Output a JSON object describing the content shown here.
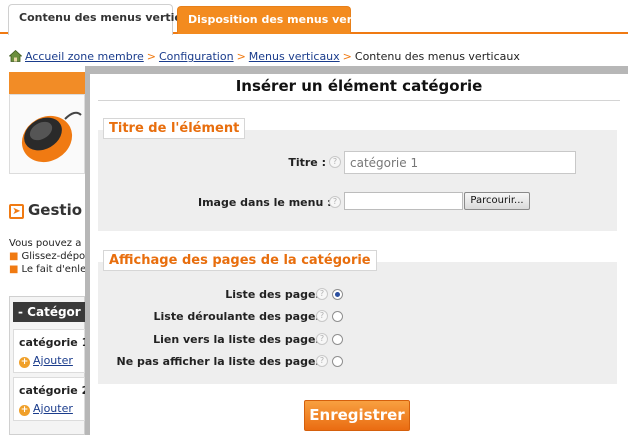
{
  "tabs": [
    {
      "label": "Contenu des menus verticaux",
      "active": true
    },
    {
      "label": "Disposition des menus verticaux",
      "active": false
    }
  ],
  "breadcrumb": {
    "items": [
      "Accueil zone membre",
      "Configuration",
      "Menus verticaux"
    ],
    "current": "Contenu des menus verticaux",
    "separator": ">"
  },
  "background": {
    "section_title": "Gestio",
    "intro_text": "Vous pouvez a",
    "bullets": [
      "Glissez-dépo",
      "Le fait d'enle"
    ],
    "categories_header": "Catégor",
    "categories": [
      {
        "name": "catégorie 1",
        "add_label": "Ajouter"
      },
      {
        "name": "catégorie 2",
        "add_label": "Ajouter"
      }
    ]
  },
  "modal": {
    "title": "Insérer un élément catégorie",
    "section_element": {
      "title": "Titre de l'élément",
      "title_label": "Titre :",
      "title_value": "catégorie 1",
      "image_label": "Image dans le menu :",
      "browse_label": "Parcourir..."
    },
    "section_display": {
      "title": "Affichage des pages de la catégorie",
      "options": [
        {
          "label": "Liste des pages",
          "checked": true
        },
        {
          "label": "Liste déroulante des pages",
          "checked": false
        },
        {
          "label": "Lien vers la liste des pages",
          "checked": false
        },
        {
          "label": "Ne pas afficher la liste des pages",
          "checked": false
        }
      ]
    },
    "save_label": "Enregistrer"
  },
  "colors": {
    "accent_orange": "#f07a12",
    "link_blue": "#1a3c8c",
    "modal_frame_gray": "#b7b7b7",
    "section_gray": "#eeeeee"
  },
  "icons": [
    "home-icon",
    "help-icon",
    "arrow-right-icon",
    "plus-icon",
    "mouse-icon"
  ]
}
